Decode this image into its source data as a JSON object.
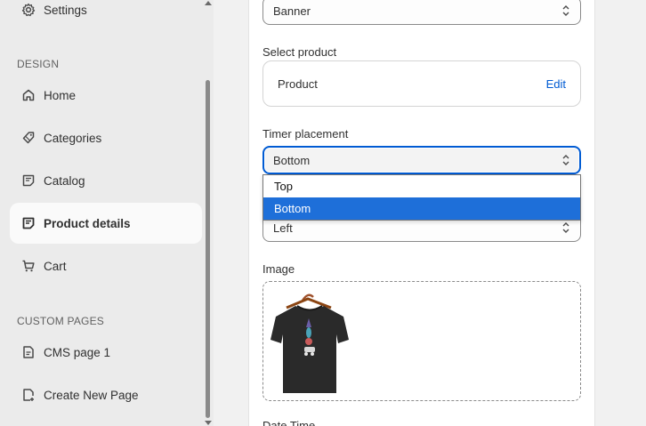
{
  "sidebar": {
    "settings_label": "Settings",
    "design_header": "DESIGN",
    "design_items": [
      {
        "label": "Home",
        "icon": "home-icon"
      },
      {
        "label": "Categories",
        "icon": "tag-icon"
      },
      {
        "label": "Catalog",
        "icon": "catalog-icon"
      },
      {
        "label": "Product details",
        "icon": "product-details-icon",
        "active": true
      },
      {
        "label": "Cart",
        "icon": "cart-icon"
      }
    ],
    "custom_pages_header": "CUSTOM PAGES",
    "custom_items": [
      {
        "label": "CMS page 1",
        "icon": "page-icon"
      },
      {
        "label": "Create New Page",
        "icon": "add-page-icon"
      }
    ]
  },
  "form": {
    "type_value": "Banner",
    "select_product_label": "Select product",
    "product_name": "Product",
    "edit_label": "Edit",
    "timer_placement_label": "Timer placement",
    "timer_placement_value": "Bottom",
    "timer_options": [
      "Top",
      "Bottom"
    ],
    "alignment_value": "Left",
    "image_label": "Image",
    "next_label": "Date Time"
  },
  "colors": {
    "accent": "#005bd3",
    "selected_option": "#1e6fd9",
    "sidebar_bg": "#ebebeb"
  }
}
